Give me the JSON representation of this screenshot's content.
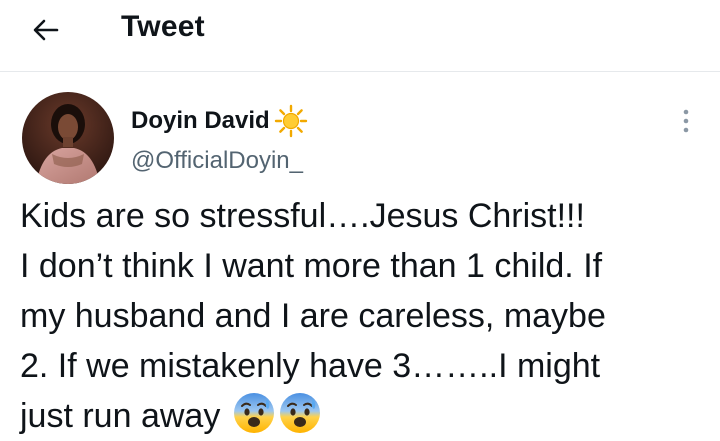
{
  "header": {
    "title": "Tweet",
    "back_icon": "arrow-left-icon"
  },
  "tweet": {
    "author": {
      "display_name": "Doyin David",
      "badge_icon": "sun-emoji-icon",
      "handle": "@OfficialDoyin_",
      "avatar_icon": "profile-avatar"
    },
    "more_icon": "more-vertical-icon",
    "text_lines": [
      "Kids are so stressful….Jesus Christ!!!",
      "I don’t think I want more than 1 child. If",
      "my husband and I are careless, maybe",
      "2.  If we mistakenly have 3……..I might",
      "just run away"
    ],
    "trailing_emojis": [
      "anxious-face-with-sweat-emoji",
      "anxious-face-with-sweat-emoji"
    ]
  },
  "colors": {
    "text_primary": "#0f1419",
    "text_secondary": "#536471",
    "divider": "#e6e9ec"
  }
}
